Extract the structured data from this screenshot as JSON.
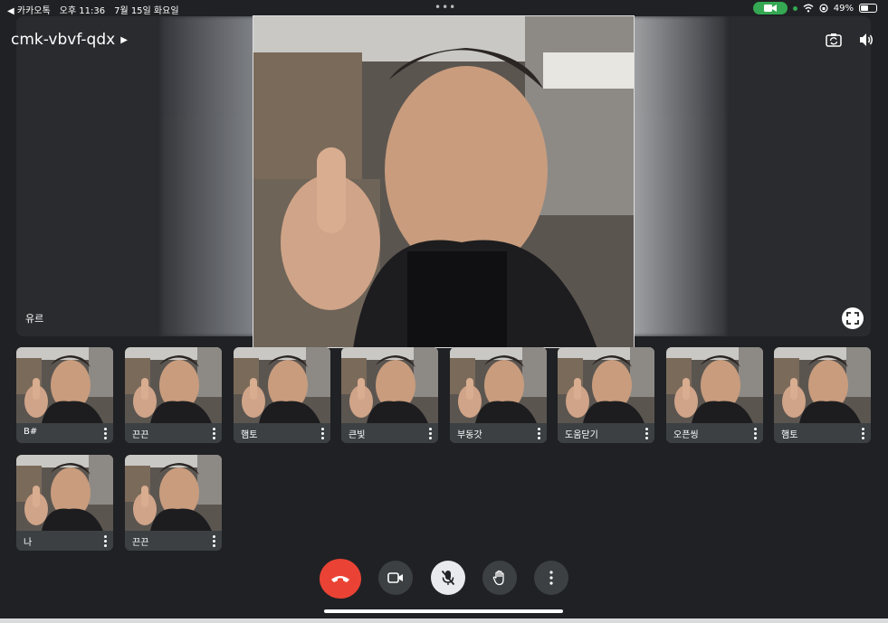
{
  "status_bar": {
    "back_label": "◀ 카카오톡",
    "time": "오후 11:36",
    "date": "7월 15일 화요일",
    "dots": "•••",
    "battery": "49%"
  },
  "meeting": {
    "code": "cmk-vbvf-qdx",
    "main_speaker": "유르"
  },
  "tiles": [
    {
      "name": "B#"
    },
    {
      "name": "끈끈"
    },
    {
      "name": "햄토"
    },
    {
      "name": "큰빛"
    },
    {
      "name": "부동갓"
    },
    {
      "name": "도움닫기"
    },
    {
      "name": "오픈씽"
    },
    {
      "name": "햄토"
    },
    {
      "name": "나"
    },
    {
      "name": "끈끈"
    }
  ],
  "colors": {
    "background": "#202124",
    "end_call": "#ea4335",
    "camera_indicator": "#34a853"
  }
}
